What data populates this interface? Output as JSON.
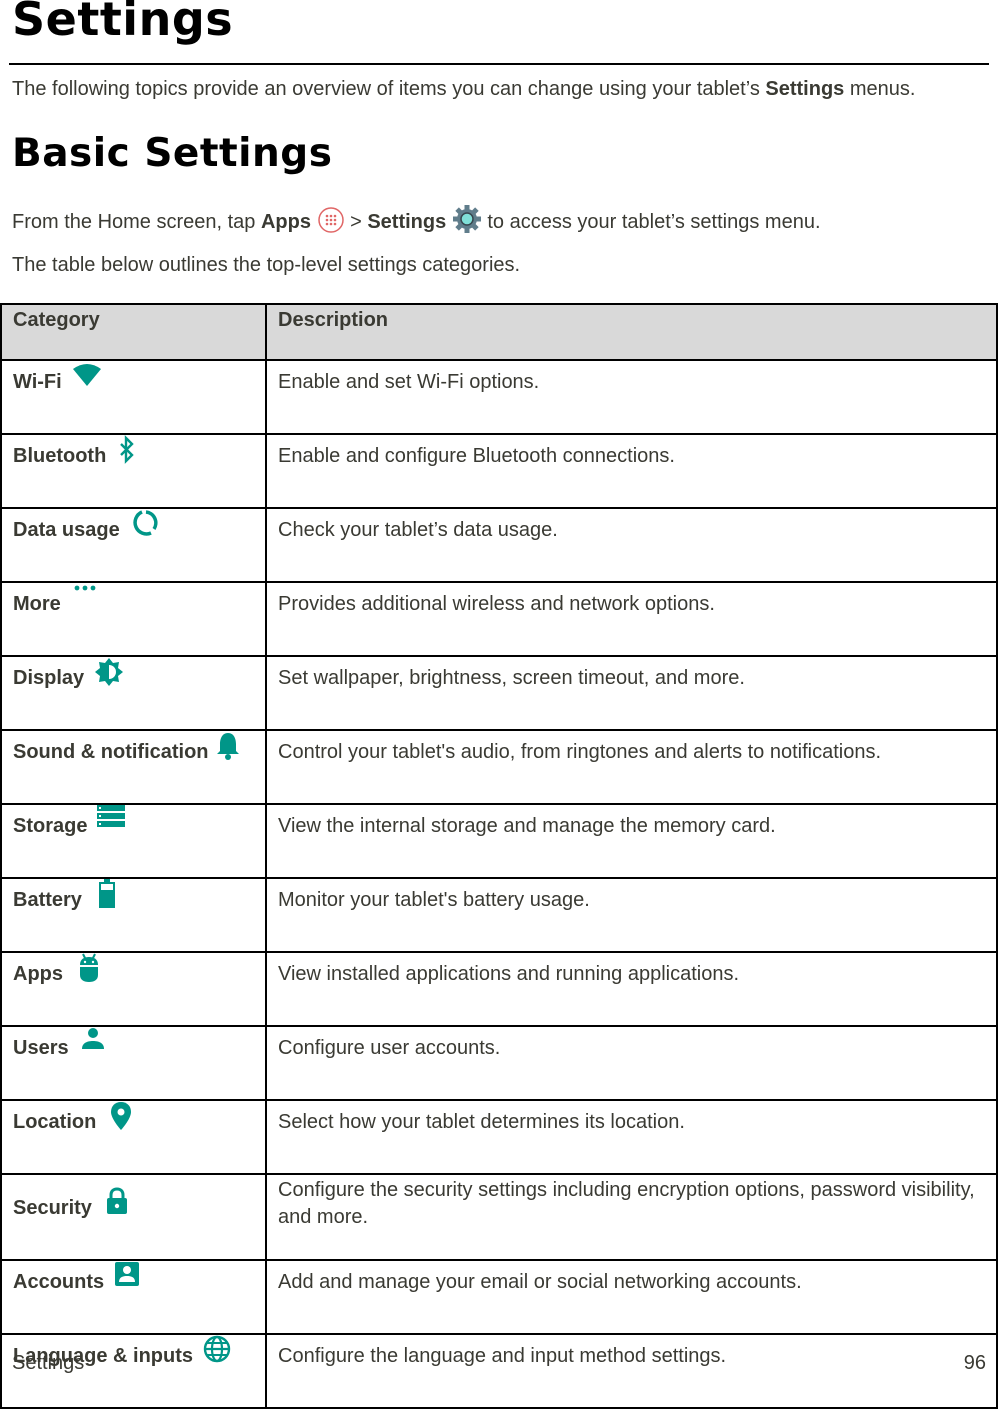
{
  "page": {
    "title": "Settings",
    "intro": {
      "before": "The following topics provide an overview of items you can change using your tablet’s ",
      "bold": "Settings",
      "after": " menus."
    },
    "section_title": "Basic Settings",
    "access_instructions": {
      "t1": "From the Home screen, tap ",
      "apps": "Apps",
      "apps_icon": "apps-launcher-icon",
      "sep": " > ",
      "settings": "Settings",
      "settings_icon": "gear-icon",
      "t2": "  to access your tablet’s settings menu."
    },
    "table_intro": "The table below outlines the top-level settings categories."
  },
  "table": {
    "headers": {
      "category": "Category",
      "description": "Description"
    },
    "rows": [
      {
        "category": "Wi-Fi",
        "icon": "wifi-icon",
        "description": "Enable and set Wi-Fi options."
      },
      {
        "category": "Bluetooth",
        "icon": "bluetooth-icon",
        "description": "Enable and configure Bluetooth connections."
      },
      {
        "category": "Data usage",
        "icon": "data-usage-icon",
        "description": "Check your tablet’s data usage."
      },
      {
        "category": "More",
        "icon": "more-dots-icon",
        "description": "Provides additional wireless and network options."
      },
      {
        "category": "Display",
        "icon": "brightness-icon",
        "description": "Set wallpaper, brightness, screen timeout, and more."
      },
      {
        "category": "Sound & notification",
        "icon": "bell-icon",
        "description": "Control your tablet's audio, from ringtones and alerts to notifications."
      },
      {
        "category": "Storage",
        "icon": "storage-icon",
        "description": "View the internal storage and manage the memory card."
      },
      {
        "category": "Battery",
        "icon": "battery-icon",
        "description": "Monitor your tablet's battery usage."
      },
      {
        "category": "Apps",
        "icon": "android-icon",
        "description": "View installed applications and running applications."
      },
      {
        "category": "Users",
        "icon": "user-icon",
        "description": "Configure user accounts."
      },
      {
        "category": "Location",
        "icon": "location-pin-icon",
        "description": "Select how your tablet determines its location."
      },
      {
        "category": "Security",
        "icon": "lock-icon",
        "description": "Configure the security settings including encryption options, password visibility, and more."
      },
      {
        "category": "Accounts",
        "icon": "account-box-icon",
        "description": "Add and manage your email or social networking accounts."
      },
      {
        "category": "Language & inputs",
        "icon": "globe-icon",
        "description": "Configure the language and input method settings."
      }
    ]
  },
  "colors": {
    "icon_teal": "#009688",
    "header_bg": "#d9d9d9",
    "text": "#3a3a33"
  },
  "footer": {
    "section": "Settings",
    "page_number": "96"
  }
}
